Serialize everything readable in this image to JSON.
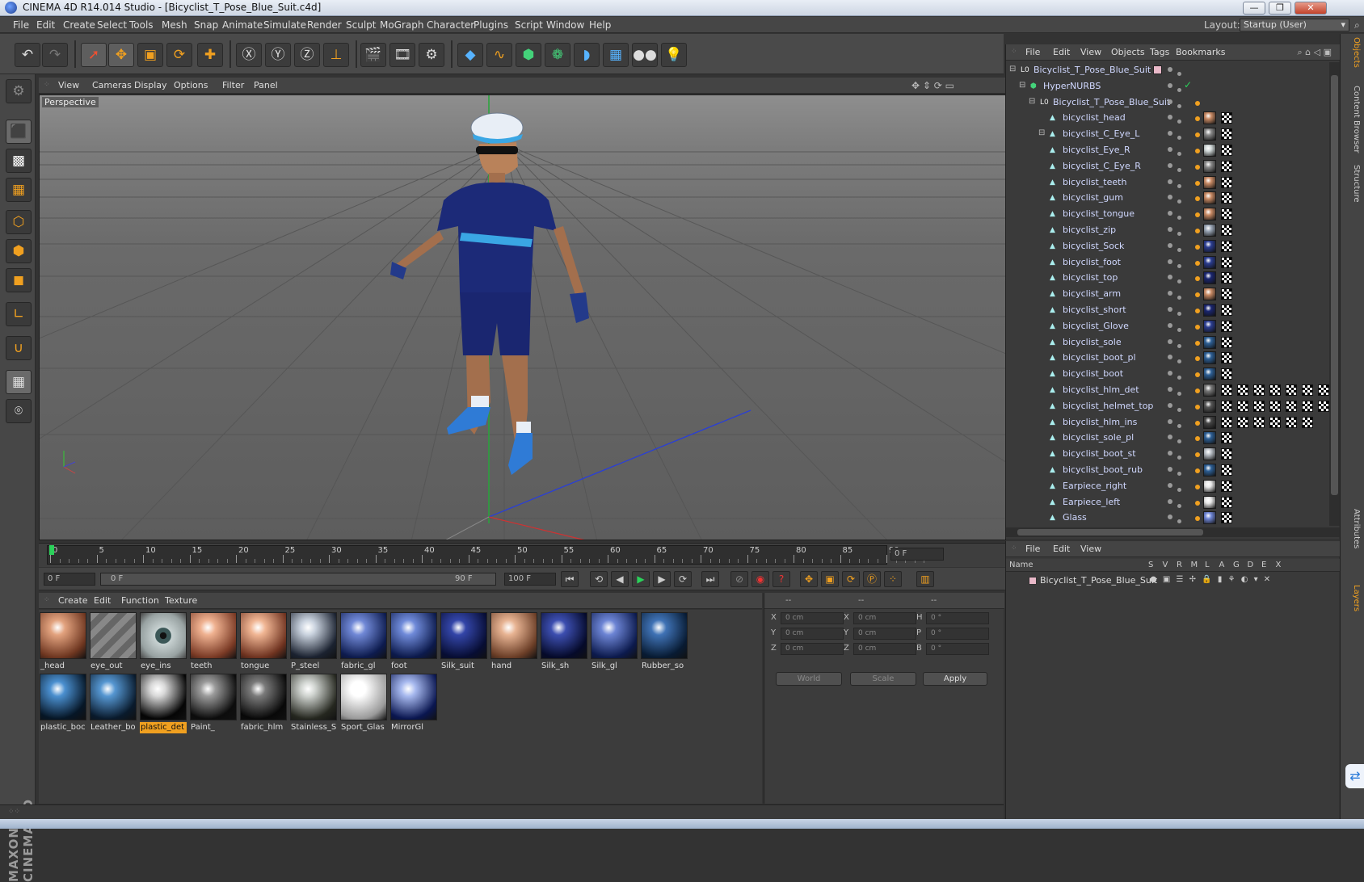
{
  "window": {
    "title": "CINEMA 4D R14.014 Studio - [Bicyclist_T_Pose_Blue_Suit.c4d]",
    "min": "—",
    "max": "❐",
    "close": "✕"
  },
  "menu": [
    "File",
    "Edit",
    "Create",
    "Select",
    "Tools",
    "Mesh",
    "Snap",
    "Animate",
    "Simulate",
    "Render",
    "Sculpt",
    "MoGraph",
    "Character",
    "Plugins",
    "Script",
    "Window",
    "Help"
  ],
  "layout": {
    "label": "Layout:",
    "value": "Startup (User)"
  },
  "viewport": {
    "menu": [
      "View",
      "Cameras",
      "Display",
      "Options",
      "Filter",
      "Panel"
    ],
    "label": "Perspective"
  },
  "timeline": {
    "ticks": [
      "0",
      "5",
      "10",
      "15",
      "20",
      "25",
      "30",
      "35",
      "40",
      "45",
      "50",
      "55",
      "60",
      "65",
      "70",
      "75",
      "80",
      "85",
      "90"
    ],
    "current": "0 F",
    "start": "0 F",
    "range_start": "0 F",
    "range_end": "90 F",
    "end": "100 F"
  },
  "materials": {
    "menu": [
      "Create",
      "Edit",
      "Function",
      "Texture"
    ],
    "items": [
      {
        "label": "_head",
        "c1": "#e2a27e",
        "c2": "#6e3620"
      },
      {
        "label": "eye_out",
        "c1": "#9a9a9a",
        "c2": "#5a5a5a",
        "striped": true
      },
      {
        "label": "eye_ins",
        "c1": "#dfe8e8",
        "c2": "#3b4f4f",
        "eye": true
      },
      {
        "label": "teeth",
        "c1": "#efb190",
        "c2": "#7a3a25"
      },
      {
        "label": "tongue",
        "c1": "#f0b593",
        "c2": "#6f3320"
      },
      {
        "label": "P_steel",
        "c1": "#c9d2de",
        "c2": "#1b2230"
      },
      {
        "label": "fabric_gl",
        "c1": "#7088d6",
        "c2": "#0d1b4e"
      },
      {
        "label": "foot",
        "c1": "#6f8ad9",
        "c2": "#0c1a4c"
      },
      {
        "label": "Silk_suit",
        "c1": "#3345a8",
        "c2": "#070d33"
      },
      {
        "label": "hand",
        "c1": "#e7b392",
        "c2": "#6b3e27"
      },
      {
        "label": "Silk_sh",
        "c1": "#3c4eb0",
        "c2": "#050a2a"
      },
      {
        "label": "Silk_gl",
        "c1": "#6c84d4",
        "c2": "#0c1a4d"
      },
      {
        "label": "Rubber_so",
        "c1": "#3f72b5",
        "c2": "#081b33"
      },
      {
        "label": "plastic_boc",
        "c1": "#4a8fcf",
        "c2": "#061626"
      },
      {
        "label": "Leather_bo",
        "c1": "#5596d1",
        "c2": "#091a2c"
      },
      {
        "label": "plastic_det",
        "c1": "#d8d8d8",
        "c2": "#050505",
        "selected": true
      },
      {
        "label": "Paint_",
        "c1": "#9a9a9a",
        "c2": "#0c0c0c"
      },
      {
        "label": "fabric_hlm",
        "c1": "#7a7a7a",
        "c2": "#080808"
      },
      {
        "label": "Stainless_S",
        "c1": "#cfd3cf",
        "c2": "#25271f"
      },
      {
        "label": "Sport_Glas",
        "c1": "#ffffff",
        "c2": "#9a9a9a"
      },
      {
        "label": "MirrorGl",
        "c1": "#a6b8ee",
        "c2": "#0a1650"
      }
    ]
  },
  "coords": {
    "head": [
      "--",
      "--",
      "--"
    ],
    "rows": [
      [
        "X",
        "0 cm",
        "X",
        "0 cm",
        "H",
        "0 °"
      ],
      [
        "Y",
        "0 cm",
        "Y",
        "0 cm",
        "P",
        "0 °"
      ],
      [
        "Z",
        "0 cm",
        "Z",
        "0 cm",
        "B",
        "0 °"
      ]
    ],
    "world": "World",
    "scale": "Scale",
    "apply": "Apply"
  },
  "objects": {
    "menu": [
      "File",
      "Edit",
      "View",
      "Objects",
      "Tags",
      "Bookmarks"
    ],
    "rows": [
      {
        "name": "Bicyclist_T_Pose_Blue_Suit",
        "indent": 0,
        "type": "null"
      },
      {
        "name": "HyperNURBS",
        "indent": 1,
        "type": "nurbs"
      },
      {
        "name": "Bicyclist_T_Pose_Blue_Suit",
        "indent": 2,
        "type": "null"
      },
      {
        "name": "bicyclist_head",
        "indent": 3,
        "type": "mesh",
        "mat": "#c98a64"
      },
      {
        "name": "bicyclist_C_Eye_L",
        "indent": 3,
        "type": "mesh",
        "mat": "#888888",
        "expand": true
      },
      {
        "name": "bicyclist_Eye_R",
        "indent": 3,
        "type": "mesh",
        "mat": "#d0d8d8"
      },
      {
        "name": "bicyclist_C_Eye_R",
        "indent": 3,
        "type": "mesh",
        "mat": "#888888"
      },
      {
        "name": "bicyclist_teeth",
        "indent": 3,
        "type": "mesh",
        "mat": "#c98a64"
      },
      {
        "name": "bicyclist_gum",
        "indent": 3,
        "type": "mesh",
        "mat": "#c98a64"
      },
      {
        "name": "bicyclist_tongue",
        "indent": 3,
        "type": "mesh",
        "mat": "#c98a64"
      },
      {
        "name": "bicyclist_zip",
        "indent": 3,
        "type": "mesh",
        "mat": "#9aa6b6"
      },
      {
        "name": "bicyclist_Sock",
        "indent": 3,
        "type": "mesh",
        "mat": "#2a3c90"
      },
      {
        "name": "bicyclist_foot",
        "indent": 3,
        "type": "mesh",
        "mat": "#2a3c90"
      },
      {
        "name": "bicyclist_top",
        "indent": 3,
        "type": "mesh",
        "mat": "#1a2670"
      },
      {
        "name": "bicyclist_arm",
        "indent": 3,
        "type": "mesh",
        "mat": "#c98a64"
      },
      {
        "name": "bicyclist_short",
        "indent": 3,
        "type": "mesh",
        "mat": "#1a2670"
      },
      {
        "name": "bicyclist_Glove",
        "indent": 3,
        "type": "mesh",
        "mat": "#2a3c90"
      },
      {
        "name": "bicyclist_sole",
        "indent": 3,
        "type": "mesh",
        "mat": "#2d5f95"
      },
      {
        "name": "bicyclist_boot_pl",
        "indent": 3,
        "type": "mesh",
        "mat": "#2d5f95"
      },
      {
        "name": "bicyclist_boot",
        "indent": 3,
        "type": "mesh",
        "mat": "#2d5f95"
      },
      {
        "name": "bicyclist_hlm_det",
        "indent": 3,
        "type": "mesh",
        "mat": "#777777",
        "extra": 6
      },
      {
        "name": "bicyclist_helmet_top",
        "indent": 3,
        "type": "mesh",
        "mat": "#555555",
        "extra": 6
      },
      {
        "name": "bicyclist_hlm_ins",
        "indent": 3,
        "type": "mesh",
        "mat": "#444444",
        "extra": 5
      },
      {
        "name": "bicyclist_sole_pl",
        "indent": 3,
        "type": "mesh",
        "mat": "#2d5f95"
      },
      {
        "name": "bicyclist_boot_st",
        "indent": 3,
        "type": "mesh",
        "mat": "#b9bfc6"
      },
      {
        "name": "bicyclist_boot_rub",
        "indent": 3,
        "type": "mesh",
        "mat": "#2d5f95"
      },
      {
        "name": "Earpiece_right",
        "indent": 3,
        "type": "mesh",
        "mat": "#e8e8e8"
      },
      {
        "name": "Earpiece_left",
        "indent": 3,
        "type": "mesh",
        "mat": "#e8e8e8"
      },
      {
        "name": "Glass",
        "indent": 3,
        "type": "mesh",
        "mat": "#6f86d6"
      }
    ]
  },
  "layers": {
    "menu": [
      "File",
      "Edit",
      "View"
    ],
    "cols": [
      "Name",
      "S",
      "V",
      "R",
      "M",
      "L",
      "A",
      "G",
      "D",
      "E",
      "X"
    ],
    "row": "Bicyclist_T_Pose_Blue_Suit"
  },
  "right_tabs": [
    "Objects",
    "Content Browser",
    "Structure",
    "Attributes",
    "Layers"
  ],
  "brand": "MAXON CINEMA 4D"
}
